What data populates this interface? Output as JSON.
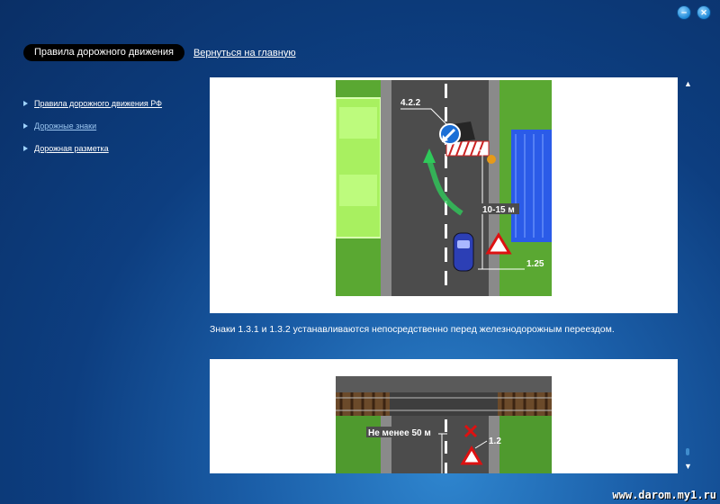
{
  "window": {
    "minimize_glyph": "–",
    "close_glyph": "✕"
  },
  "header": {
    "active_tab_label": "Правила дорожного движения",
    "back_link_label": "Вернуться на главную"
  },
  "sidebar": {
    "items": [
      {
        "label": "Правила дорожного движения РФ"
      },
      {
        "label": "Дорожные знаки"
      },
      {
        "label": "Дорожная разметка"
      }
    ]
  },
  "content": {
    "figure1": {
      "sign_label": "4.2.2",
      "distance_label": "10-15 м",
      "marking_label": "1.25"
    },
    "caption1": "Знаки 1.3.1 и 1.3.2 устанавливаются непосредственно перед железнодорожным переездом.",
    "figure2": {
      "distance_label": "Не менее 50 м",
      "sign_label": "1.2"
    }
  },
  "scrollbar": {
    "up_glyph": "▲",
    "down_glyph": "▼"
  },
  "watermark": "www.darom.my1.ru",
  "colors": {
    "accent": "#1b5fa9",
    "pill": "#000000"
  }
}
